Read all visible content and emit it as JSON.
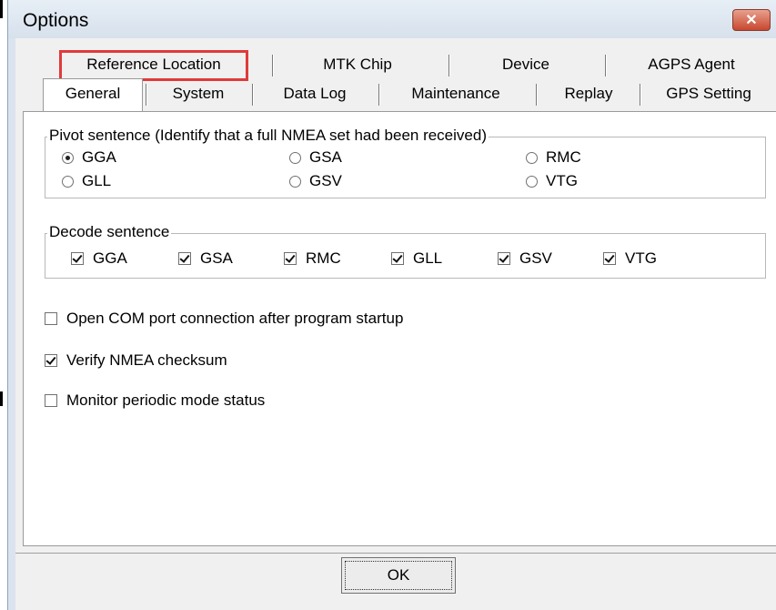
{
  "window": {
    "title": "Options",
    "close_glyph": "✕"
  },
  "tabs": {
    "row_top": [
      "Reference Location",
      "MTK Chip",
      "Device",
      "AGPS Agent"
    ],
    "row_bottom": [
      "General",
      "System",
      "Data Log",
      "Maintenance",
      "Replay",
      "GPS Setting"
    ],
    "selected": "General",
    "highlighted": "Reference Location",
    "highlight_color": "#e03a3a"
  },
  "pivot": {
    "legend": "Pivot sentence (Identify that a full NMEA set had been received)",
    "options": [
      "GGA",
      "GSA",
      "RMC",
      "GLL",
      "GSV",
      "VTG"
    ],
    "selected": "GGA"
  },
  "decode": {
    "legend": "Decode sentence",
    "options": [
      {
        "label": "GGA",
        "checked": true
      },
      {
        "label": "GSA",
        "checked": true
      },
      {
        "label": "RMC",
        "checked": true
      },
      {
        "label": "GLL",
        "checked": true
      },
      {
        "label": "GSV",
        "checked": true
      },
      {
        "label": "VTG",
        "checked": true
      }
    ]
  },
  "settings": [
    {
      "label": "Open COM port connection after program startup",
      "checked": false
    },
    {
      "label": "Verify NMEA checksum",
      "checked": true
    },
    {
      "label": "Monitor periodic mode status",
      "checked": false
    }
  ],
  "buttons": {
    "ok": "OK"
  }
}
